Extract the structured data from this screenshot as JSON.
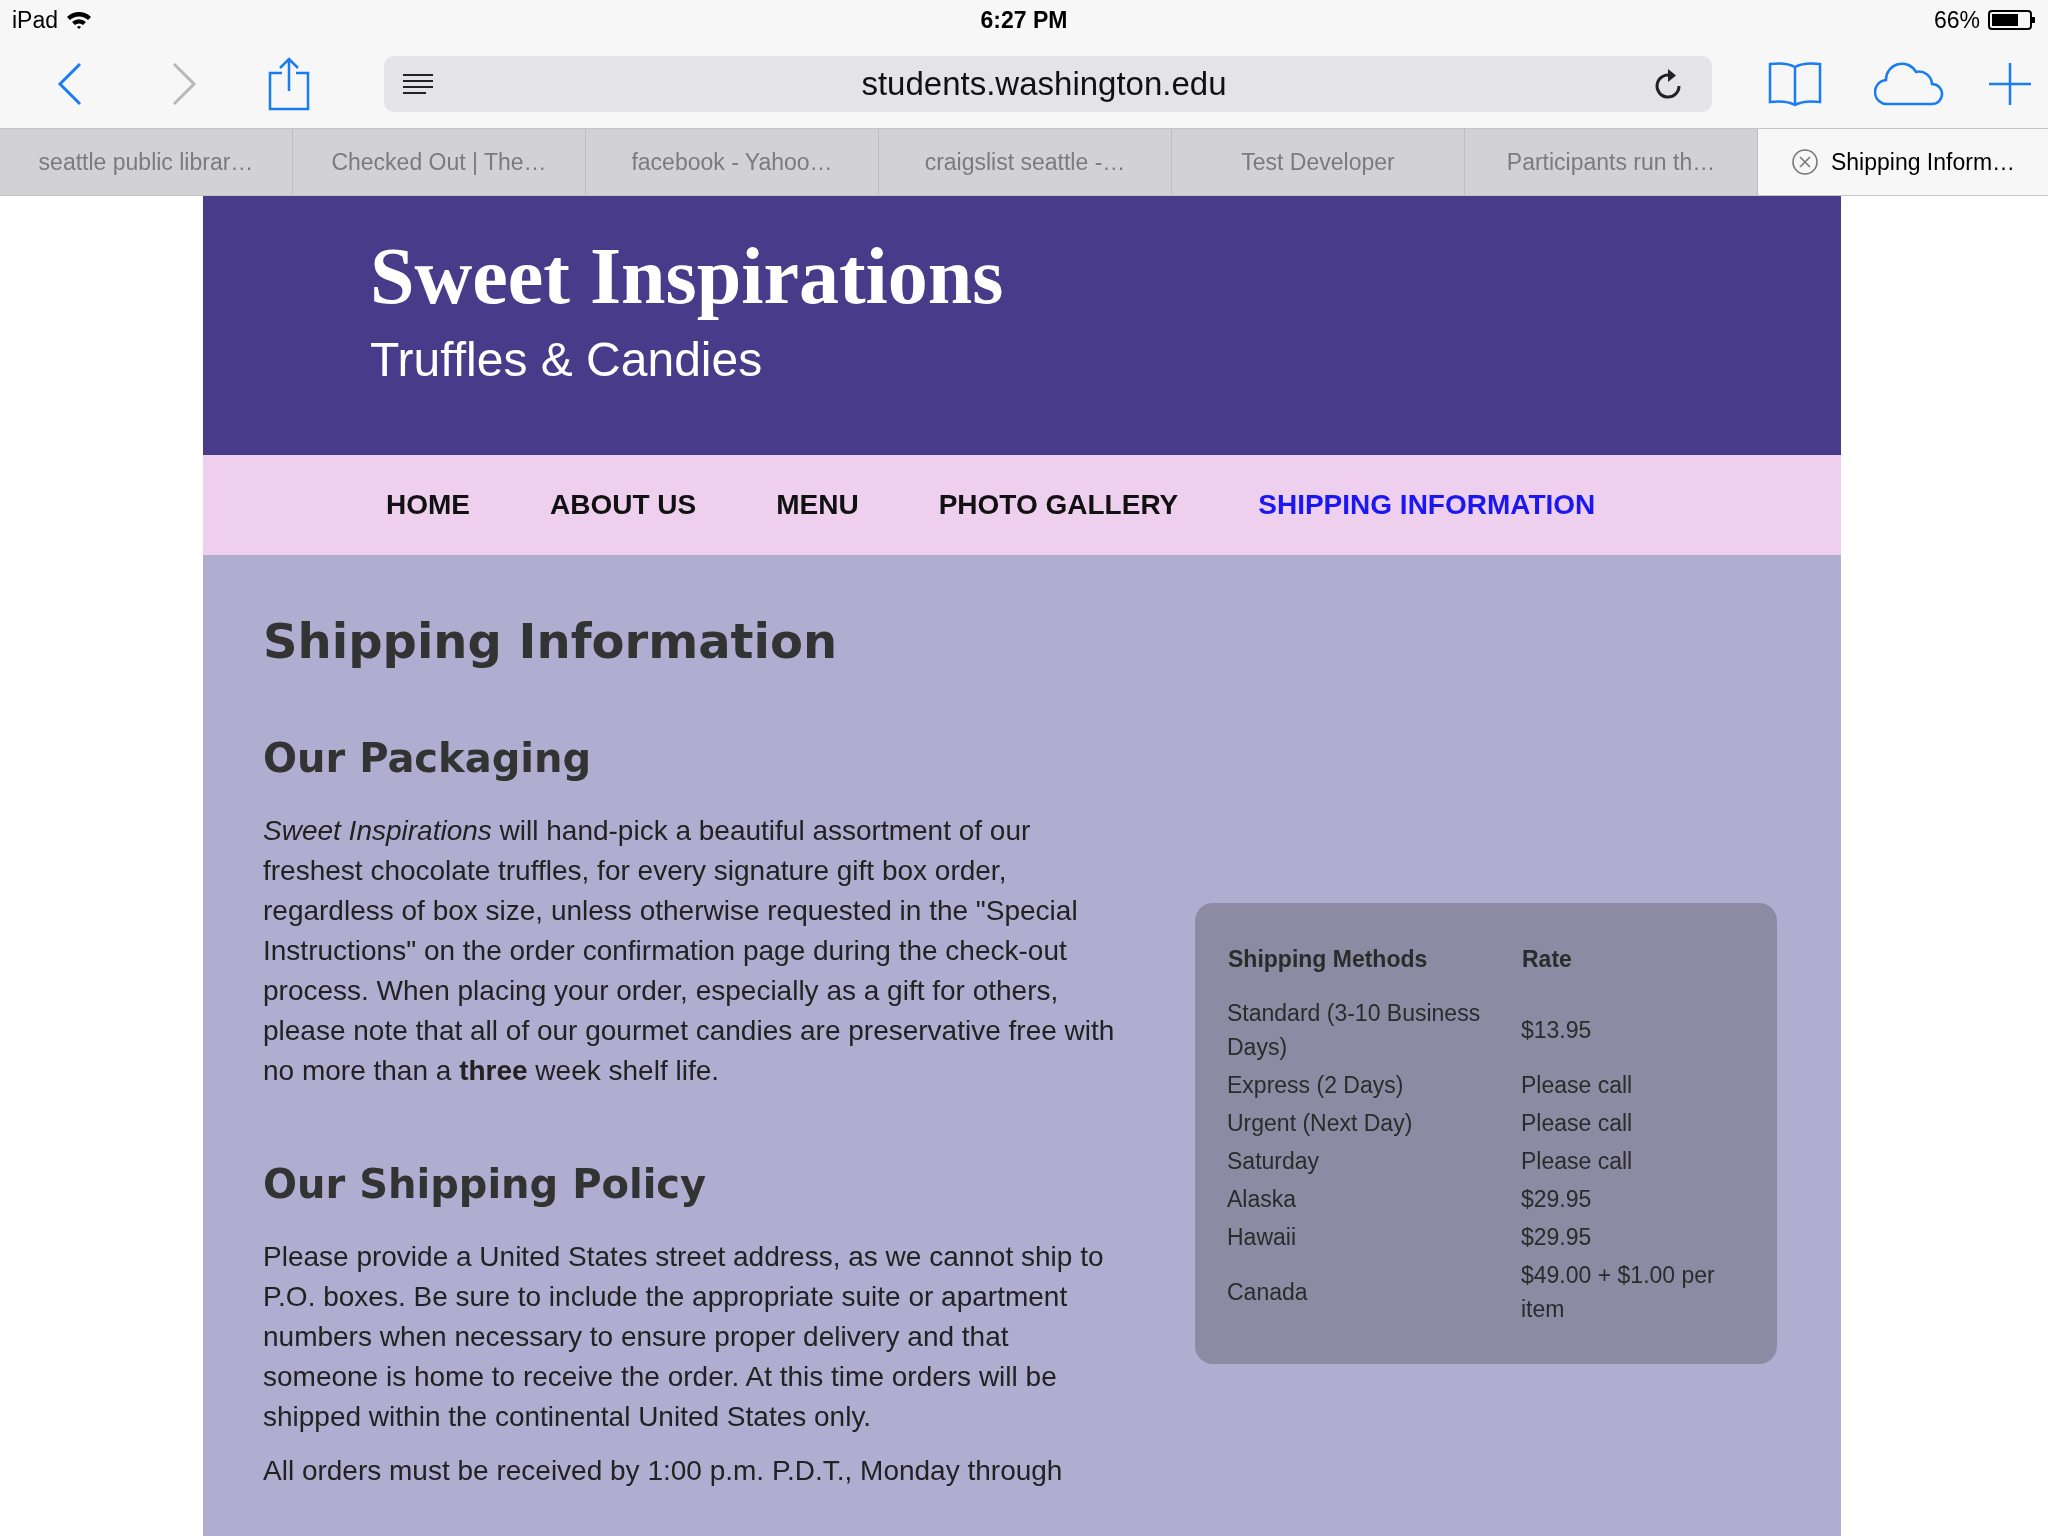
{
  "status_bar": {
    "device": "iPad",
    "time": "6:27 PM",
    "battery": "66%"
  },
  "browser": {
    "url": "students.washington.edu"
  },
  "tabs": [
    {
      "label": "seattle public librar…",
      "selected": false
    },
    {
      "label": "Checked Out | The…",
      "selected": false
    },
    {
      "label": "facebook - Yahoo…",
      "selected": false
    },
    {
      "label": "craigslist seattle -…",
      "selected": false
    },
    {
      "label": "Test Developer",
      "selected": false
    },
    {
      "label": "Participants run th…",
      "selected": false
    },
    {
      "label": "Shipping Inform…",
      "selected": true
    }
  ],
  "site": {
    "title": "Sweet Inspirations",
    "subtitle": "Truffles & Candies"
  },
  "nav": [
    {
      "label": "HOME",
      "selected": false
    },
    {
      "label": "ABOUT US",
      "selected": false
    },
    {
      "label": "MENU",
      "selected": false
    },
    {
      "label": "PHOTO GALLERY",
      "selected": false
    },
    {
      "label": "SHIPPING INFORMATION",
      "selected": true
    }
  ],
  "page_title": "Shipping Information",
  "sections": [
    {
      "heading": "Our Packaging",
      "paragraphs": [
        "*Sweet Inspirations* will hand-pick a beautiful assortment of our freshest chocolate truffles, for every signature gift box order, regardless of box size, unless otherwise requested in the \"Special Instructions\" on the order confirmation page during the check-out process. When placing your order, especially as a gift for others, please note that all of our gourmet candies are preservative free with no more than a **three** week shelf life."
      ]
    },
    {
      "heading": "Our Shipping Policy",
      "paragraphs": [
        "Please provide a United States street address, as we cannot ship to P.O. boxes. Be sure to include the appropriate suite or apartment numbers when necessary to ensure proper delivery and that someone is home to receive the order. At this time orders will be shipped within the continental United States only.",
        "All orders must be received by 1:00 p.m. P.D.T., Monday through"
      ]
    }
  ],
  "table": {
    "columns": [
      "Shipping Methods",
      "Rate"
    ],
    "rows": [
      [
        "Standard (3-10 Business Days)",
        "$13.95"
      ],
      [
        "Express (2 Days)",
        "Please call"
      ],
      [
        "Urgent (Next Day)",
        "Please call"
      ],
      [
        "Saturday",
        "Please call"
      ],
      [
        "Alaska",
        "$29.95"
      ],
      [
        "Hawaii",
        "$29.95"
      ],
      [
        "Canada",
        "$49.00 + $1.00 per item"
      ]
    ]
  }
}
